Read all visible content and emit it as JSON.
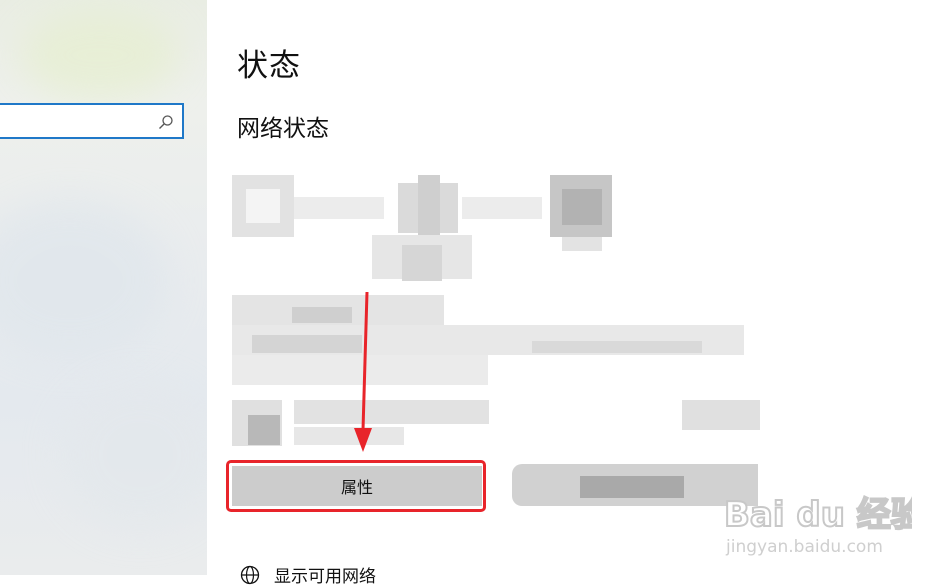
{
  "page": {
    "title": "状态",
    "section_title": "网络状态"
  },
  "search": {
    "value": "",
    "icon": "search-icon"
  },
  "buttons": {
    "properties_label": "属性",
    "secondary_label": ""
  },
  "bottom_link": {
    "label": "显示可用网络",
    "icon": "globe-icon"
  },
  "watermark": {
    "logo_text": "Bai du 经验",
    "url": "jingyan.baidu.com"
  },
  "colors": {
    "accent": "#1f78c8",
    "highlight": "#e8242a",
    "button": "#cccccc"
  }
}
